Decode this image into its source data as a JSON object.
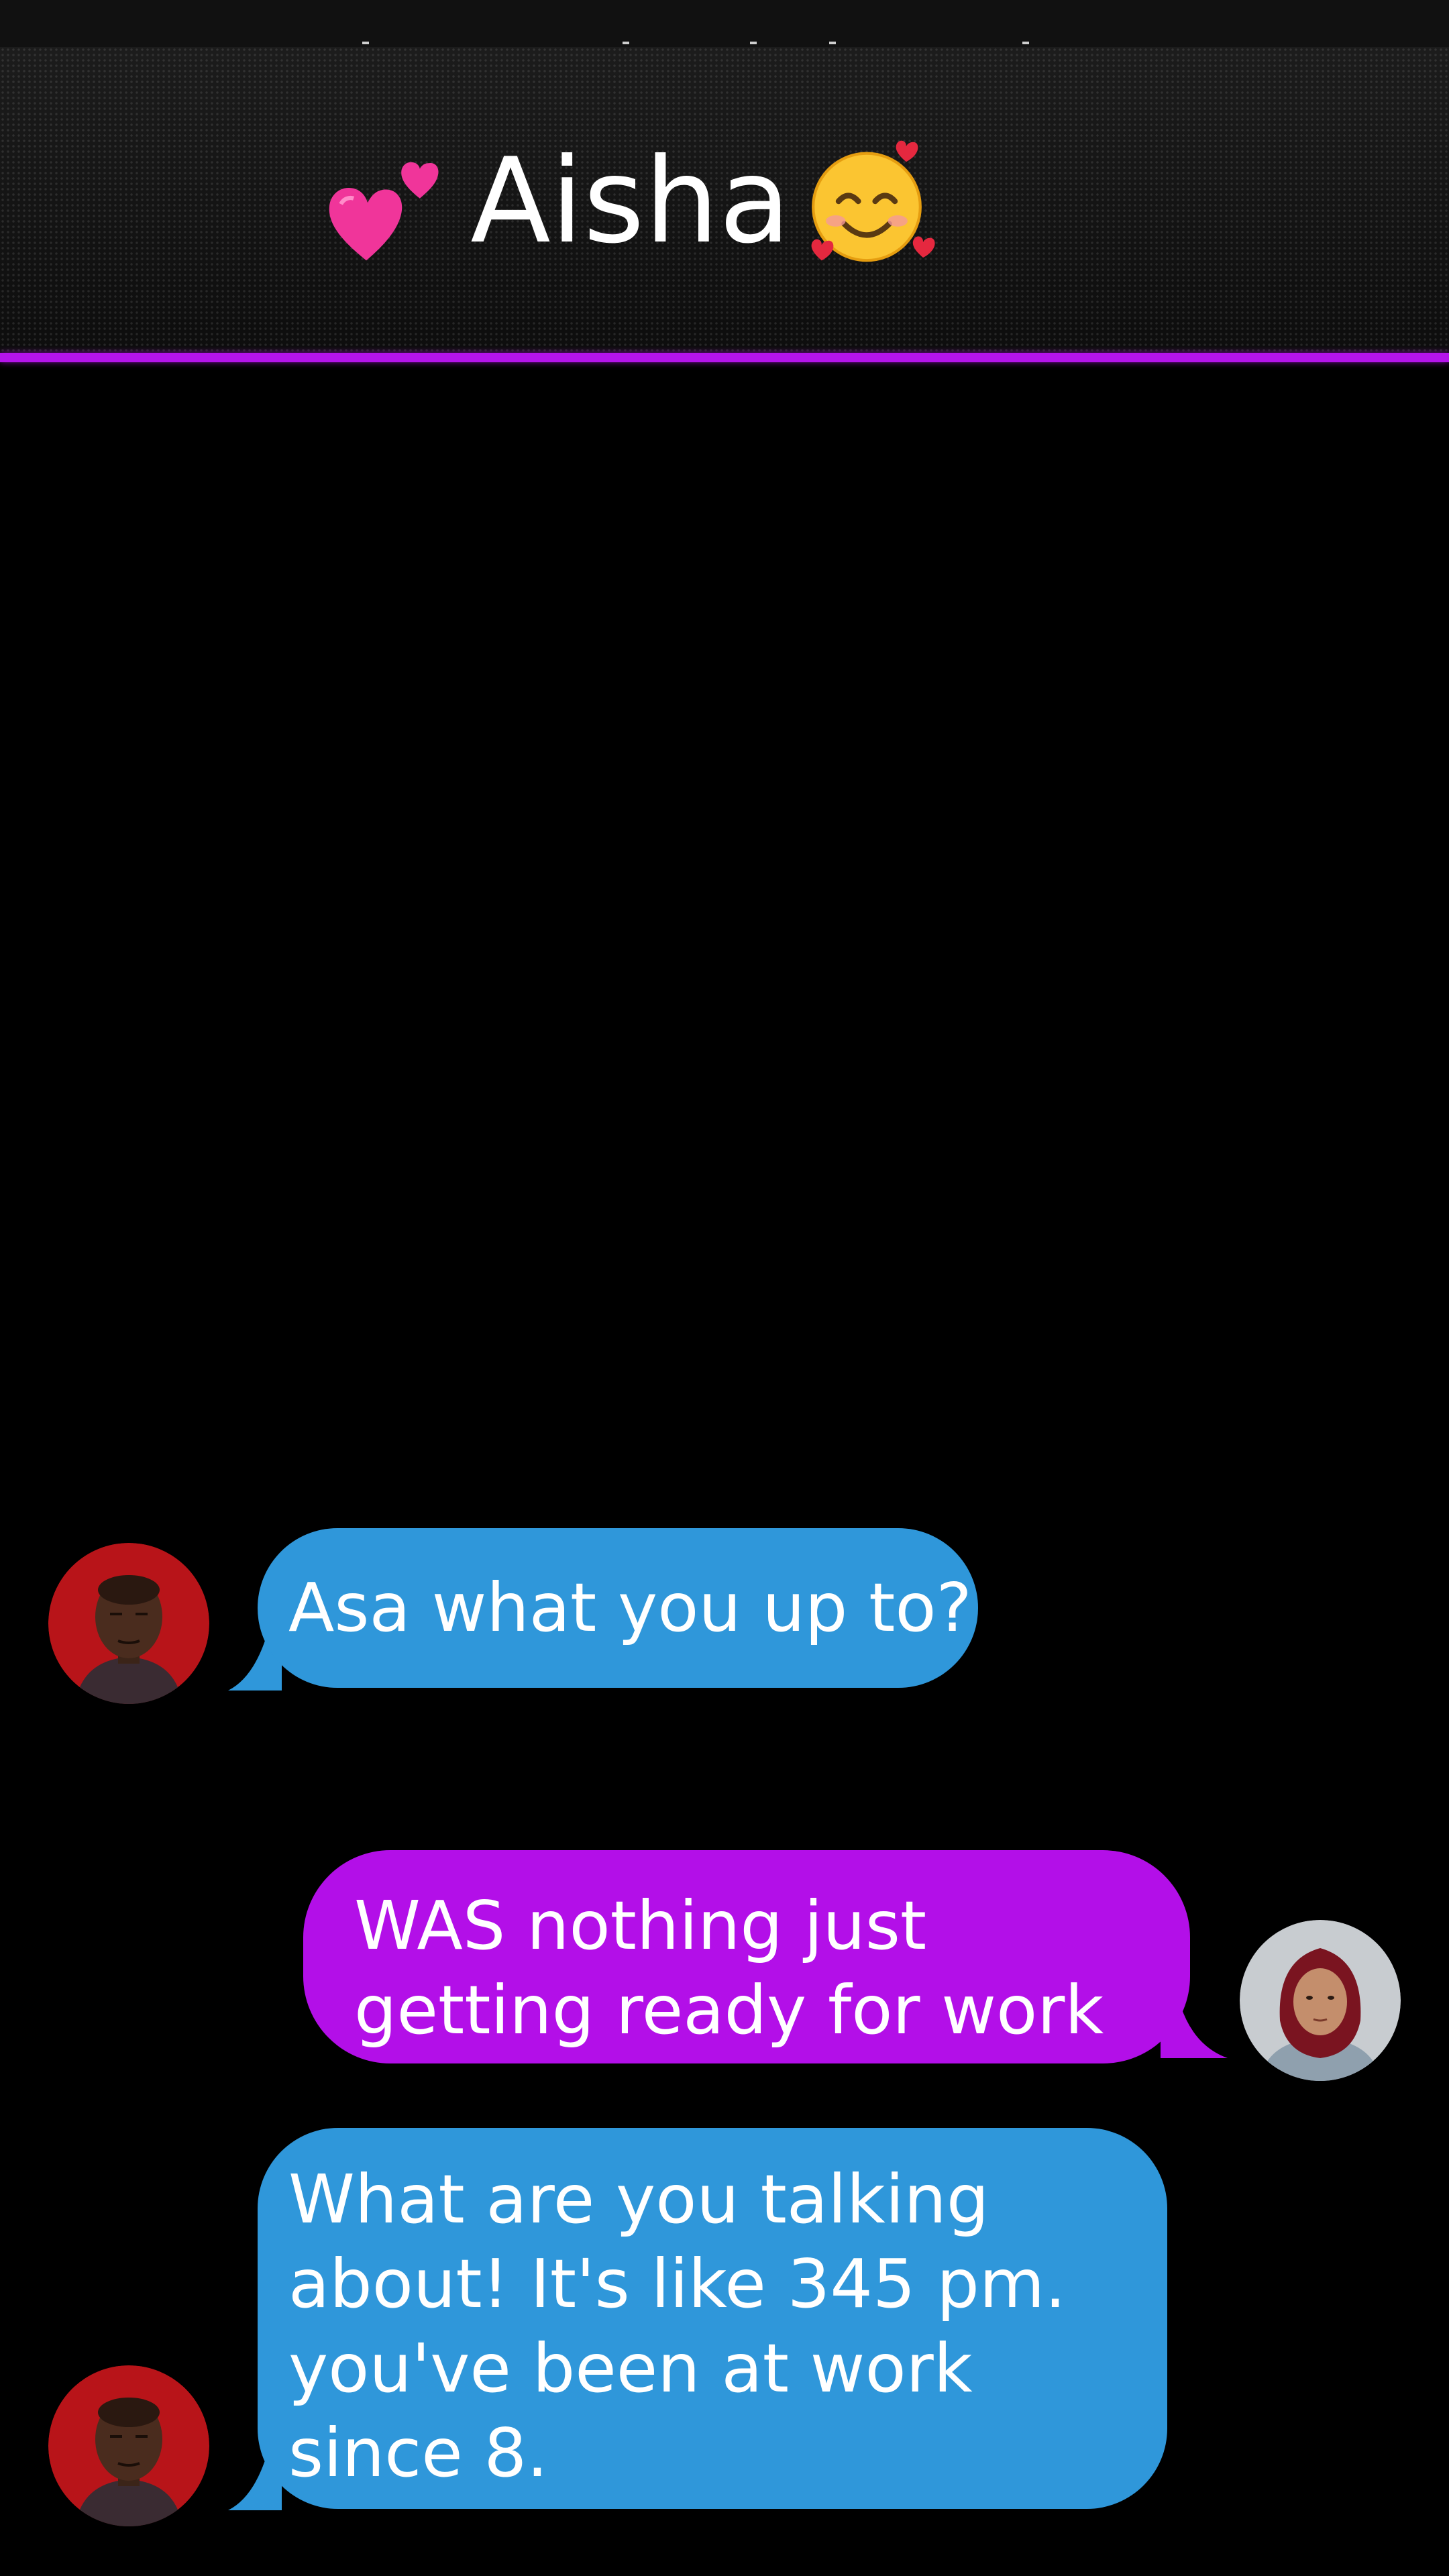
{
  "header": {
    "title": "Aisha",
    "left_emoji": "two-hearts-icon",
    "right_emoji": "smiling-face-with-hearts-icon"
  },
  "colors": {
    "accent": "#b514ec",
    "incoming_bubble": "#2f97da",
    "outgoing_bubble": "#b30fe8",
    "background": "#000000"
  },
  "messages": [
    {
      "sender": "contact",
      "text": "Asa what you up to?"
    },
    {
      "sender": "aisha",
      "text": "WAS nothing just getting ready for work"
    },
    {
      "sender": "contact",
      "text": "What are you talking about! It's like 345 pm. you've been at work since 8."
    }
  ]
}
